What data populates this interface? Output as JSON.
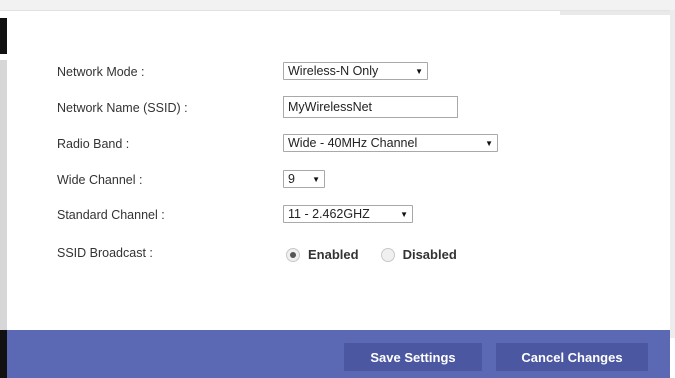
{
  "form": {
    "network_mode": {
      "label": "Network Mode :",
      "value": "Wireless-N Only"
    },
    "network_name": {
      "label": "Network Name (SSID) :",
      "value": "MyWirelessNet"
    },
    "radio_band": {
      "label": "Radio Band :",
      "value": "Wide - 40MHz Channel"
    },
    "wide_channel": {
      "label": "Wide Channel :",
      "value": "9"
    },
    "standard_channel": {
      "label": "Standard Channel :",
      "value": "11 - 2.462GHZ"
    },
    "ssid_broadcast": {
      "label": "SSID Broadcast :",
      "options": [
        "Enabled",
        "Disabled"
      ],
      "selected": "Enabled"
    }
  },
  "footer": {
    "save_label": "Save Settings",
    "cancel_label": "Cancel Changes"
  },
  "colors": {
    "footer_bg": "#5b69b5",
    "button_bg": "#4b57a0"
  }
}
